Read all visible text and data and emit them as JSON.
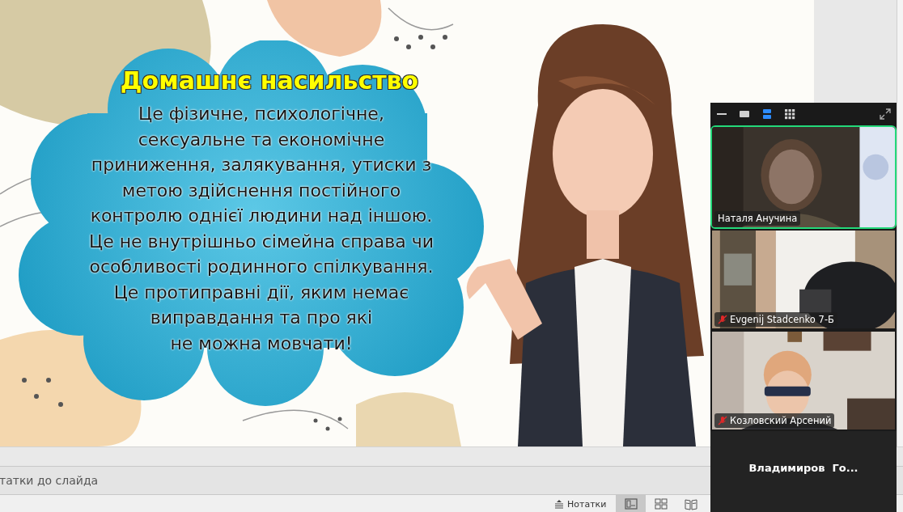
{
  "slide": {
    "title": "Домашнє насильство",
    "body": "Це фізичне, психологічне,\nсексуальне та економічне\nприниження, залякування, утиски з\nметою здійснення постійного\nконтролю однієї людини над іншою.\nЦе не внутрішньо сімейна справа чи\nособливості родинного спілкування.\nЦе протиправні дії, яким немає\nвиправдання та про які\nне можна мовчати!"
  },
  "notes_pane": {
    "placeholder": "татки до слайда"
  },
  "status_bar": {
    "notes_button": "Нотатки",
    "views": [
      {
        "kind": "normal",
        "selected": true
      },
      {
        "kind": "sorter",
        "selected": false
      },
      {
        "kind": "reading",
        "selected": false
      }
    ]
  },
  "video_panel": {
    "view_modes": [
      {
        "kind": "minimize",
        "selected": false
      },
      {
        "kind": "speaker",
        "selected": false
      },
      {
        "kind": "strip",
        "selected": true
      },
      {
        "kind": "gallery",
        "selected": false
      }
    ],
    "tiles": [
      {
        "name": "Наталя Анучина",
        "kind": "video",
        "speaking": true,
        "muted": false
      },
      {
        "name": "Evgenij Stadcenko 7-Б",
        "kind": "video",
        "speaking": false,
        "muted": true
      },
      {
        "name": "Козловский Арсений",
        "kind": "video",
        "speaking": false,
        "muted": true
      },
      {
        "name": "Владимиров  Го...",
        "kind": "no_video",
        "speaking": false,
        "muted": false
      }
    ]
  }
}
